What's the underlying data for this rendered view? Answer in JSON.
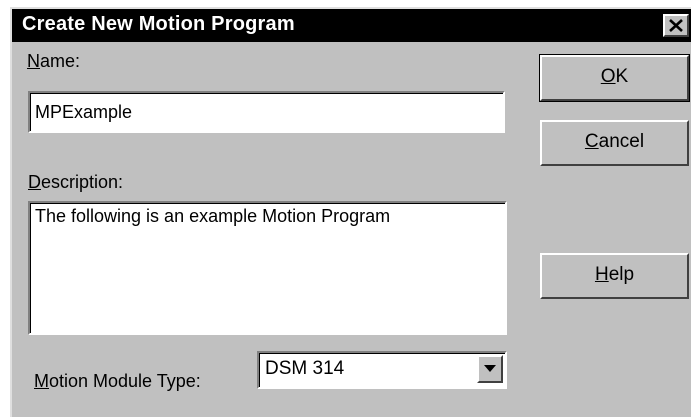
{
  "window": {
    "title": "Create New Motion Program",
    "close_icon": "close-icon"
  },
  "form": {
    "name_label_key": "N",
    "name_label_rest": "ame:",
    "name_value": "MPExample",
    "description_label_key": "D",
    "description_label_rest": "escription:",
    "description_value": "The following is an example Motion Program",
    "module_type_label_key": "M",
    "module_type_label_rest": "otion Module Type:",
    "module_type_value": "DSM 314"
  },
  "buttons": {
    "ok_key": "O",
    "ok_rest": "K",
    "cancel_key": "C",
    "cancel_rest": "ancel",
    "help_key": "H",
    "help_rest": "elp"
  },
  "colors": {
    "dialog_bg": "#c0c0c0",
    "titlebar_bg": "#000000",
    "title_text": "#ffffff"
  }
}
